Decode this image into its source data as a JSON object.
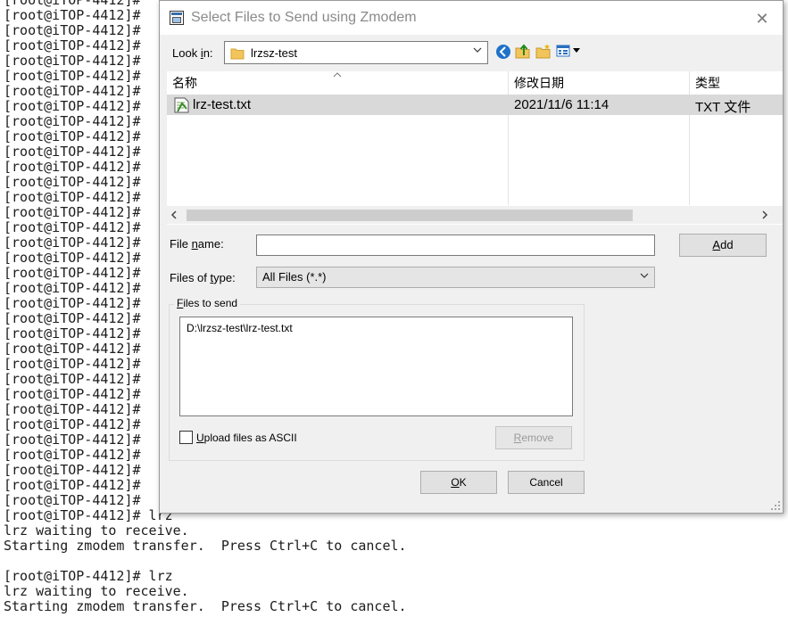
{
  "terminal": {
    "prompt": "[root@iTOP-4412]#",
    "lines": [
      "[root@iTOP-4412]#",
      "[root@iTOP-4412]#",
      "[root@iTOP-4412]#",
      "[root@iTOP-4412]#",
      "[root@iTOP-4412]#",
      "[root@iTOP-4412]#",
      "[root@iTOP-4412]#",
      "[root@iTOP-4412]#",
      "[root@iTOP-4412]#",
      "[root@iTOP-4412]#",
      "[root@iTOP-4412]#",
      "[root@iTOP-4412]#",
      "[root@iTOP-4412]#",
      "[root@iTOP-4412]#",
      "[root@iTOP-4412]#",
      "[root@iTOP-4412]#",
      "[root@iTOP-4412]#",
      "[root@iTOP-4412]#",
      "[root@iTOP-4412]#",
      "[root@iTOP-4412]#",
      "[root@iTOP-4412]#",
      "[root@iTOP-4412]#",
      "[root@iTOP-4412]#",
      "[root@iTOP-4412]#",
      "[root@iTOP-4412]#",
      "[root@iTOP-4412]#",
      "[root@iTOP-4412]#",
      "[root@iTOP-4412]#",
      "[root@iTOP-4412]#",
      "[root@iTOP-4412]#",
      "[root@iTOP-4412]#",
      "[root@iTOP-4412]#",
      "[root@iTOP-4412]#",
      "[root@iTOP-4412]#",
      "[root@iTOP-4412]# lrz",
      "lrz waiting to receive.",
      "Starting zmodem transfer.  Press Ctrl+C to cancel.",
      "",
      "[root@iTOP-4412]# lrz",
      "lrz waiting to receive.",
      "Starting zmodem transfer.  Press Ctrl+C to cancel."
    ]
  },
  "dialog": {
    "title": "Select Files to Send using Zmodem",
    "close_glyph": "✕",
    "lookin": {
      "label_pre": "Look ",
      "label_u": "i",
      "label_post": "n:",
      "value": "lrzsz-test"
    },
    "columns": [
      "名称",
      "修改日期",
      "类型"
    ],
    "files": [
      {
        "name": "lrz-test.txt",
        "date": "2021/11/6 11:14",
        "type": "TXT 文件"
      }
    ],
    "filename": {
      "label_pre": "File ",
      "label_u": "n",
      "label_post": "ame:",
      "value": ""
    },
    "filetype": {
      "label_pre": "Files of ",
      "label_u": "t",
      "label_post": "ype:",
      "value": "All Files (*.*)"
    },
    "add_button": {
      "u": "A",
      "rest": "dd"
    },
    "files_to_send": {
      "label_u": "F",
      "label_rest": "iles to send",
      "items": [
        "D:\\lrzsz-test\\lrz-test.txt"
      ]
    },
    "ascii_checkbox": {
      "u": "U",
      "rest": "pload files as ASCII",
      "checked": false
    },
    "remove_button": {
      "u": "R",
      "rest": "emove"
    },
    "ok_button": {
      "u": "O",
      "rest": "K"
    },
    "cancel_button": {
      "label": "Cancel"
    }
  },
  "icons": [
    "app-icon",
    "close-icon",
    "folder-icon",
    "back-icon",
    "up-folder-icon",
    "new-folder-icon",
    "view-menu-icon",
    "sort-arrow-icon",
    "text-file-icon",
    "dropdown-arrow-icon",
    "resize-grip-icon"
  ]
}
